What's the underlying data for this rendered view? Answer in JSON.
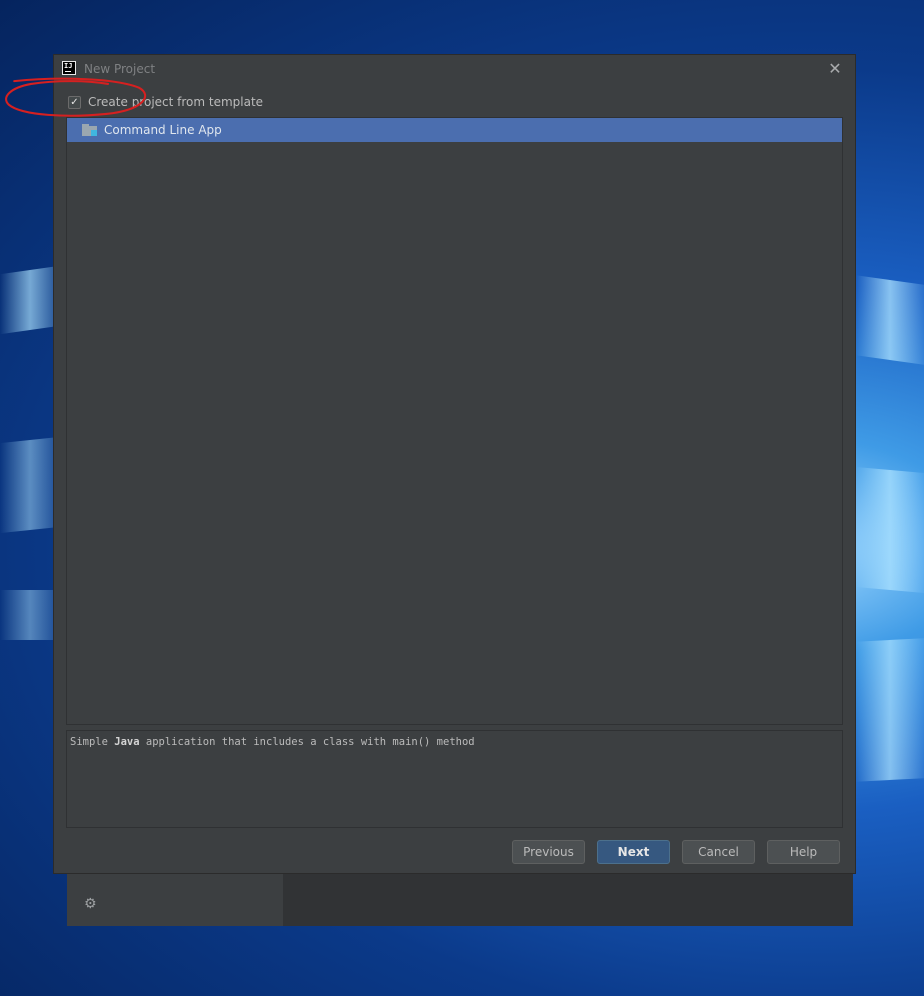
{
  "dialog": {
    "title": "New Project",
    "app_icon_text": "IJ",
    "close_glyph": "✕",
    "template_checkbox": {
      "label": "Create project from template",
      "checked": true,
      "check_glyph": "✓"
    },
    "templates": [
      {
        "label": "Command Line App",
        "selected": true,
        "icon": "folder-icon"
      }
    ],
    "description": {
      "prefix": "Simple ",
      "bold": "Java",
      "suffix": " application that includes a class with main() method"
    },
    "buttons": {
      "previous": "Previous",
      "next": "Next",
      "cancel": "Cancel",
      "help": "Help"
    }
  },
  "background_window": {
    "settings_icon": "gear-icon",
    "settings_glyph": "⚙"
  },
  "colors": {
    "dialog_bg": "#3c3f41",
    "selection": "#4b6eaf",
    "primary_button": "#365880",
    "annotation": "#d62020"
  }
}
